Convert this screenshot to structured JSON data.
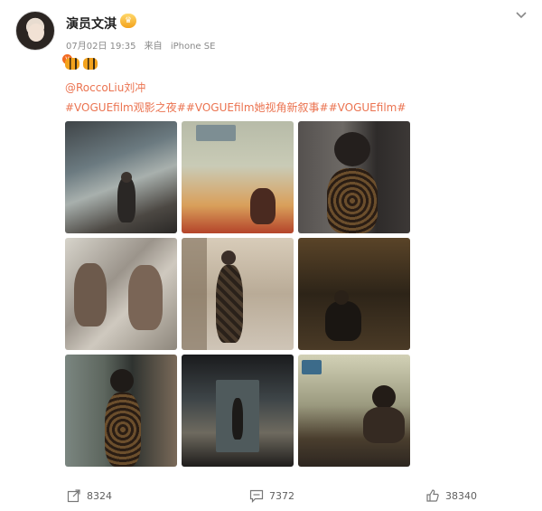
{
  "post": {
    "author": "演员文淇",
    "date": "07月02日 19:35",
    "source_prefix": "来自",
    "source_device": "iPhone SE",
    "emojis": [
      "tiger-emoji",
      "tiger-emoji"
    ],
    "mention": "@RoccoLiu刘冲",
    "hashtags": "#VOGUEfilm观影之夜##VOGUEfilm她视角新叙事##VOGUEfilm#"
  },
  "photos": [
    {
      "name": "alley-bench-photo"
    },
    {
      "name": "room-red-chair-photo"
    },
    {
      "name": "leopard-dress-closeup-photo"
    },
    {
      "name": "mirror-reflection-photo"
    },
    {
      "name": "standing-dress-photo"
    },
    {
      "name": "dark-bar-photo"
    },
    {
      "name": "street-walk-photo"
    },
    {
      "name": "doorway-photo"
    },
    {
      "name": "cafe-table-photo"
    }
  ],
  "actions": {
    "share_count": "8324",
    "comment_count": "7372",
    "like_count": "38340"
  },
  "colors": {
    "link": "#eb7350",
    "badge": "#f26a21",
    "meta_text": "#8a8a8a"
  }
}
